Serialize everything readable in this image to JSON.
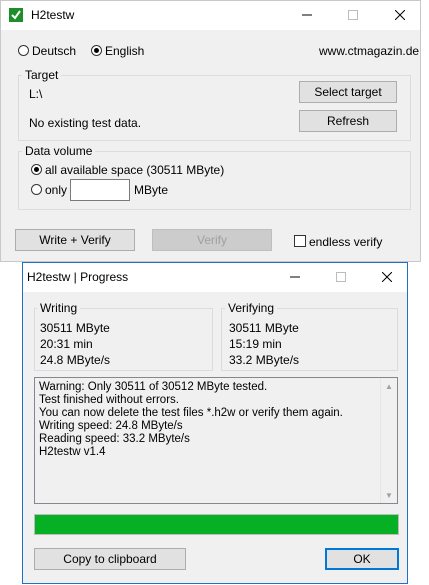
{
  "main_window": {
    "title": "H2testw",
    "language": {
      "deutsch": "Deutsch",
      "english": "English",
      "selected": "English"
    },
    "website": "www.ctmagazin.de",
    "target": {
      "label": "Target",
      "path": "L:\\",
      "status": "No existing test data.",
      "select_button": "Select target",
      "refresh_button": "Refresh"
    },
    "data_volume": {
      "label": "Data volume",
      "all_space": "all available space (30511 MByte)",
      "only": "only",
      "only_value": "",
      "unit": "MByte",
      "selected": "all available space"
    },
    "buttons": {
      "write_verify": "Write + Verify",
      "verify": "Verify",
      "endless_verify": "endless verify",
      "endless_checked": false
    }
  },
  "progress_window": {
    "title": "H2testw | Progress",
    "writing": {
      "label": "Writing",
      "amount": "30511 MByte",
      "time": "20:31 min",
      "speed": "24.8 MByte/s"
    },
    "verifying": {
      "label": "Verifying",
      "amount": "30511 MByte",
      "time": "15:19 min",
      "speed": "33.2 MByte/s"
    },
    "log": [
      "Warning: Only 30511 of 30512 MByte tested.",
      "Test finished without errors.",
      "You can now delete the test files *.h2w or verify them again.",
      "Writing speed: 24.8 MByte/s",
      "Reading speed: 33.2 MByte/s",
      "H2testw v1.4"
    ],
    "progress_fraction": 1.0,
    "progress_color": "#06b025",
    "buttons": {
      "copy": "Copy to clipboard",
      "ok": "OK"
    }
  },
  "icons": {
    "app": "h2testw-app-icon",
    "minimize": "minimize-icon",
    "maximize": "maximize-icon",
    "close": "close-icon"
  }
}
